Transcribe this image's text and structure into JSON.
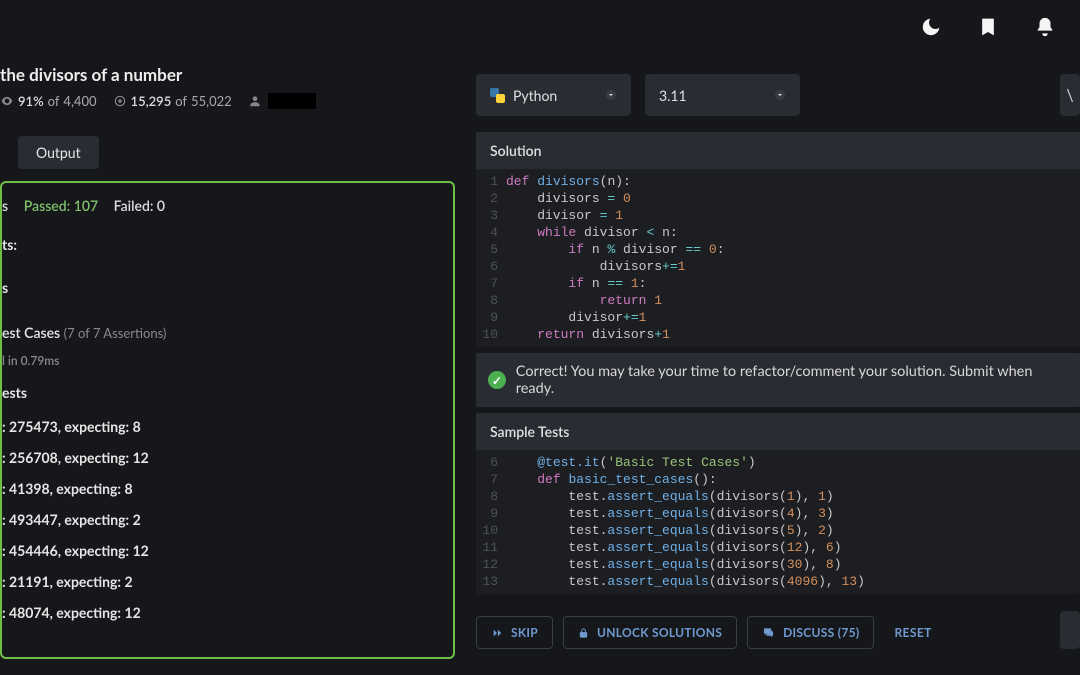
{
  "header": {
    "icons": [
      "moon",
      "bookmark",
      "bell"
    ]
  },
  "kata": {
    "title": "the divisors of a number",
    "satisfaction": {
      "percent": "91%",
      "of": "4,400"
    },
    "completed": {
      "done": "15,295",
      "of": "55,022"
    }
  },
  "tabs": {
    "output": "Output"
  },
  "results": {
    "ms_label": "s",
    "passed_label": "Passed:",
    "passed": "107",
    "failed_label": "Failed:",
    "failed": "0",
    "heading1": "ts:",
    "heading2": "s",
    "test_cases_label": "est Cases",
    "test_cases_count": "(7 of 7 Assertions)",
    "timing": "l in 0.79ms",
    "heading3": "ests",
    "lines": [
      ": 275473, expecting: 8",
      ": 256708, expecting: 12",
      ": 41398, expecting: 8",
      ": 493447, expecting: 2",
      ": 454446, expecting: 12",
      ": 21191, expecting: 2",
      ": 48074, expecting: 12"
    ]
  },
  "editor": {
    "language": "Python",
    "version": "3.11",
    "solution_label": "Solution",
    "code": [
      [
        {
          "c": "kw",
          "t": "def "
        },
        {
          "c": "fn",
          "t": "divisors"
        },
        {
          "c": "pn",
          "t": "(n):"
        }
      ],
      [
        {
          "c": "pn",
          "t": "    divisors "
        },
        {
          "c": "op",
          "t": "="
        },
        {
          "c": "pn",
          "t": " "
        },
        {
          "c": "num",
          "t": "0"
        }
      ],
      [
        {
          "c": "pn",
          "t": "    divisor "
        },
        {
          "c": "op",
          "t": "="
        },
        {
          "c": "pn",
          "t": " "
        },
        {
          "c": "num",
          "t": "1"
        }
      ],
      [
        {
          "c": "pn",
          "t": "    "
        },
        {
          "c": "kw",
          "t": "while"
        },
        {
          "c": "pn",
          "t": " divisor "
        },
        {
          "c": "op",
          "t": "<"
        },
        {
          "c": "pn",
          "t": " n:"
        }
      ],
      [
        {
          "c": "pn",
          "t": "        "
        },
        {
          "c": "kw",
          "t": "if"
        },
        {
          "c": "pn",
          "t": " n "
        },
        {
          "c": "op",
          "t": "%"
        },
        {
          "c": "pn",
          "t": " divisor "
        },
        {
          "c": "op",
          "t": "=="
        },
        {
          "c": "pn",
          "t": " "
        },
        {
          "c": "num",
          "t": "0"
        },
        {
          "c": "pn",
          "t": ":"
        }
      ],
      [
        {
          "c": "pn",
          "t": "            divisors"
        },
        {
          "c": "op",
          "t": "+="
        },
        {
          "c": "num",
          "t": "1"
        }
      ],
      [
        {
          "c": "pn",
          "t": "        "
        },
        {
          "c": "kw",
          "t": "if"
        },
        {
          "c": "pn",
          "t": " n "
        },
        {
          "c": "op",
          "t": "=="
        },
        {
          "c": "pn",
          "t": " "
        },
        {
          "c": "num",
          "t": "1"
        },
        {
          "c": "pn",
          "t": ":"
        }
      ],
      [
        {
          "c": "pn",
          "t": "            "
        },
        {
          "c": "kw",
          "t": "return"
        },
        {
          "c": "pn",
          "t": " "
        },
        {
          "c": "num",
          "t": "1"
        }
      ],
      [
        {
          "c": "pn",
          "t": "        divisor"
        },
        {
          "c": "op",
          "t": "+="
        },
        {
          "c": "num",
          "t": "1"
        }
      ],
      [
        {
          "c": "pn",
          "t": "    "
        },
        {
          "c": "kw",
          "t": "return"
        },
        {
          "c": "pn",
          "t": " divisors"
        },
        {
          "c": "op",
          "t": "+"
        },
        {
          "c": "num",
          "t": "1"
        }
      ]
    ],
    "correct_msg": "Correct! You may take your time to refactor/comment your solution. Submit when ready.",
    "tests_label": "Sample Tests",
    "test_gutter_start": 6,
    "test_code": [
      [
        {
          "c": "pn",
          "t": "    "
        },
        {
          "c": "fn",
          "t": "@test.it"
        },
        {
          "c": "pn",
          "t": "("
        },
        {
          "c": "str",
          "t": "'Basic Test Cases'"
        },
        {
          "c": "pn",
          "t": ")"
        }
      ],
      [
        {
          "c": "pn",
          "t": "    "
        },
        {
          "c": "kw",
          "t": "def "
        },
        {
          "c": "fn",
          "t": "basic_test_cases"
        },
        {
          "c": "pn",
          "t": "():"
        }
      ],
      [
        {
          "c": "pn",
          "t": "        test."
        },
        {
          "c": "fn",
          "t": "assert_equals"
        },
        {
          "c": "pn",
          "t": "(divisors("
        },
        {
          "c": "num",
          "t": "1"
        },
        {
          "c": "pn",
          "t": "), "
        },
        {
          "c": "num",
          "t": "1"
        },
        {
          "c": "pn",
          "t": ")"
        }
      ],
      [
        {
          "c": "pn",
          "t": "        test."
        },
        {
          "c": "fn",
          "t": "assert_equals"
        },
        {
          "c": "pn",
          "t": "(divisors("
        },
        {
          "c": "num",
          "t": "4"
        },
        {
          "c": "pn",
          "t": "), "
        },
        {
          "c": "num",
          "t": "3"
        },
        {
          "c": "pn",
          "t": ")"
        }
      ],
      [
        {
          "c": "pn",
          "t": "        test."
        },
        {
          "c": "fn",
          "t": "assert_equals"
        },
        {
          "c": "pn",
          "t": "(divisors("
        },
        {
          "c": "num",
          "t": "5"
        },
        {
          "c": "pn",
          "t": "), "
        },
        {
          "c": "num",
          "t": "2"
        },
        {
          "c": "pn",
          "t": ")"
        }
      ],
      [
        {
          "c": "pn",
          "t": "        test."
        },
        {
          "c": "fn",
          "t": "assert_equals"
        },
        {
          "c": "pn",
          "t": "(divisors("
        },
        {
          "c": "num",
          "t": "12"
        },
        {
          "c": "pn",
          "t": "), "
        },
        {
          "c": "num",
          "t": "6"
        },
        {
          "c": "pn",
          "t": ")"
        }
      ],
      [
        {
          "c": "pn",
          "t": "        test."
        },
        {
          "c": "fn",
          "t": "assert_equals"
        },
        {
          "c": "pn",
          "t": "(divisors("
        },
        {
          "c": "num",
          "t": "30"
        },
        {
          "c": "pn",
          "t": "), "
        },
        {
          "c": "num",
          "t": "8"
        },
        {
          "c": "pn",
          "t": ")"
        }
      ],
      [
        {
          "c": "pn",
          "t": "        test."
        },
        {
          "c": "fn",
          "t": "assert_equals"
        },
        {
          "c": "pn",
          "t": "(divisors("
        },
        {
          "c": "num",
          "t": "4096"
        },
        {
          "c": "pn",
          "t": "), "
        },
        {
          "c": "num",
          "t": "13"
        },
        {
          "c": "pn",
          "t": ")"
        }
      ]
    ]
  },
  "actions": {
    "skip": "SKIP",
    "unlock": "UNLOCK SOLUTIONS",
    "discuss": "DISCUSS (75)",
    "reset": "RESET"
  }
}
